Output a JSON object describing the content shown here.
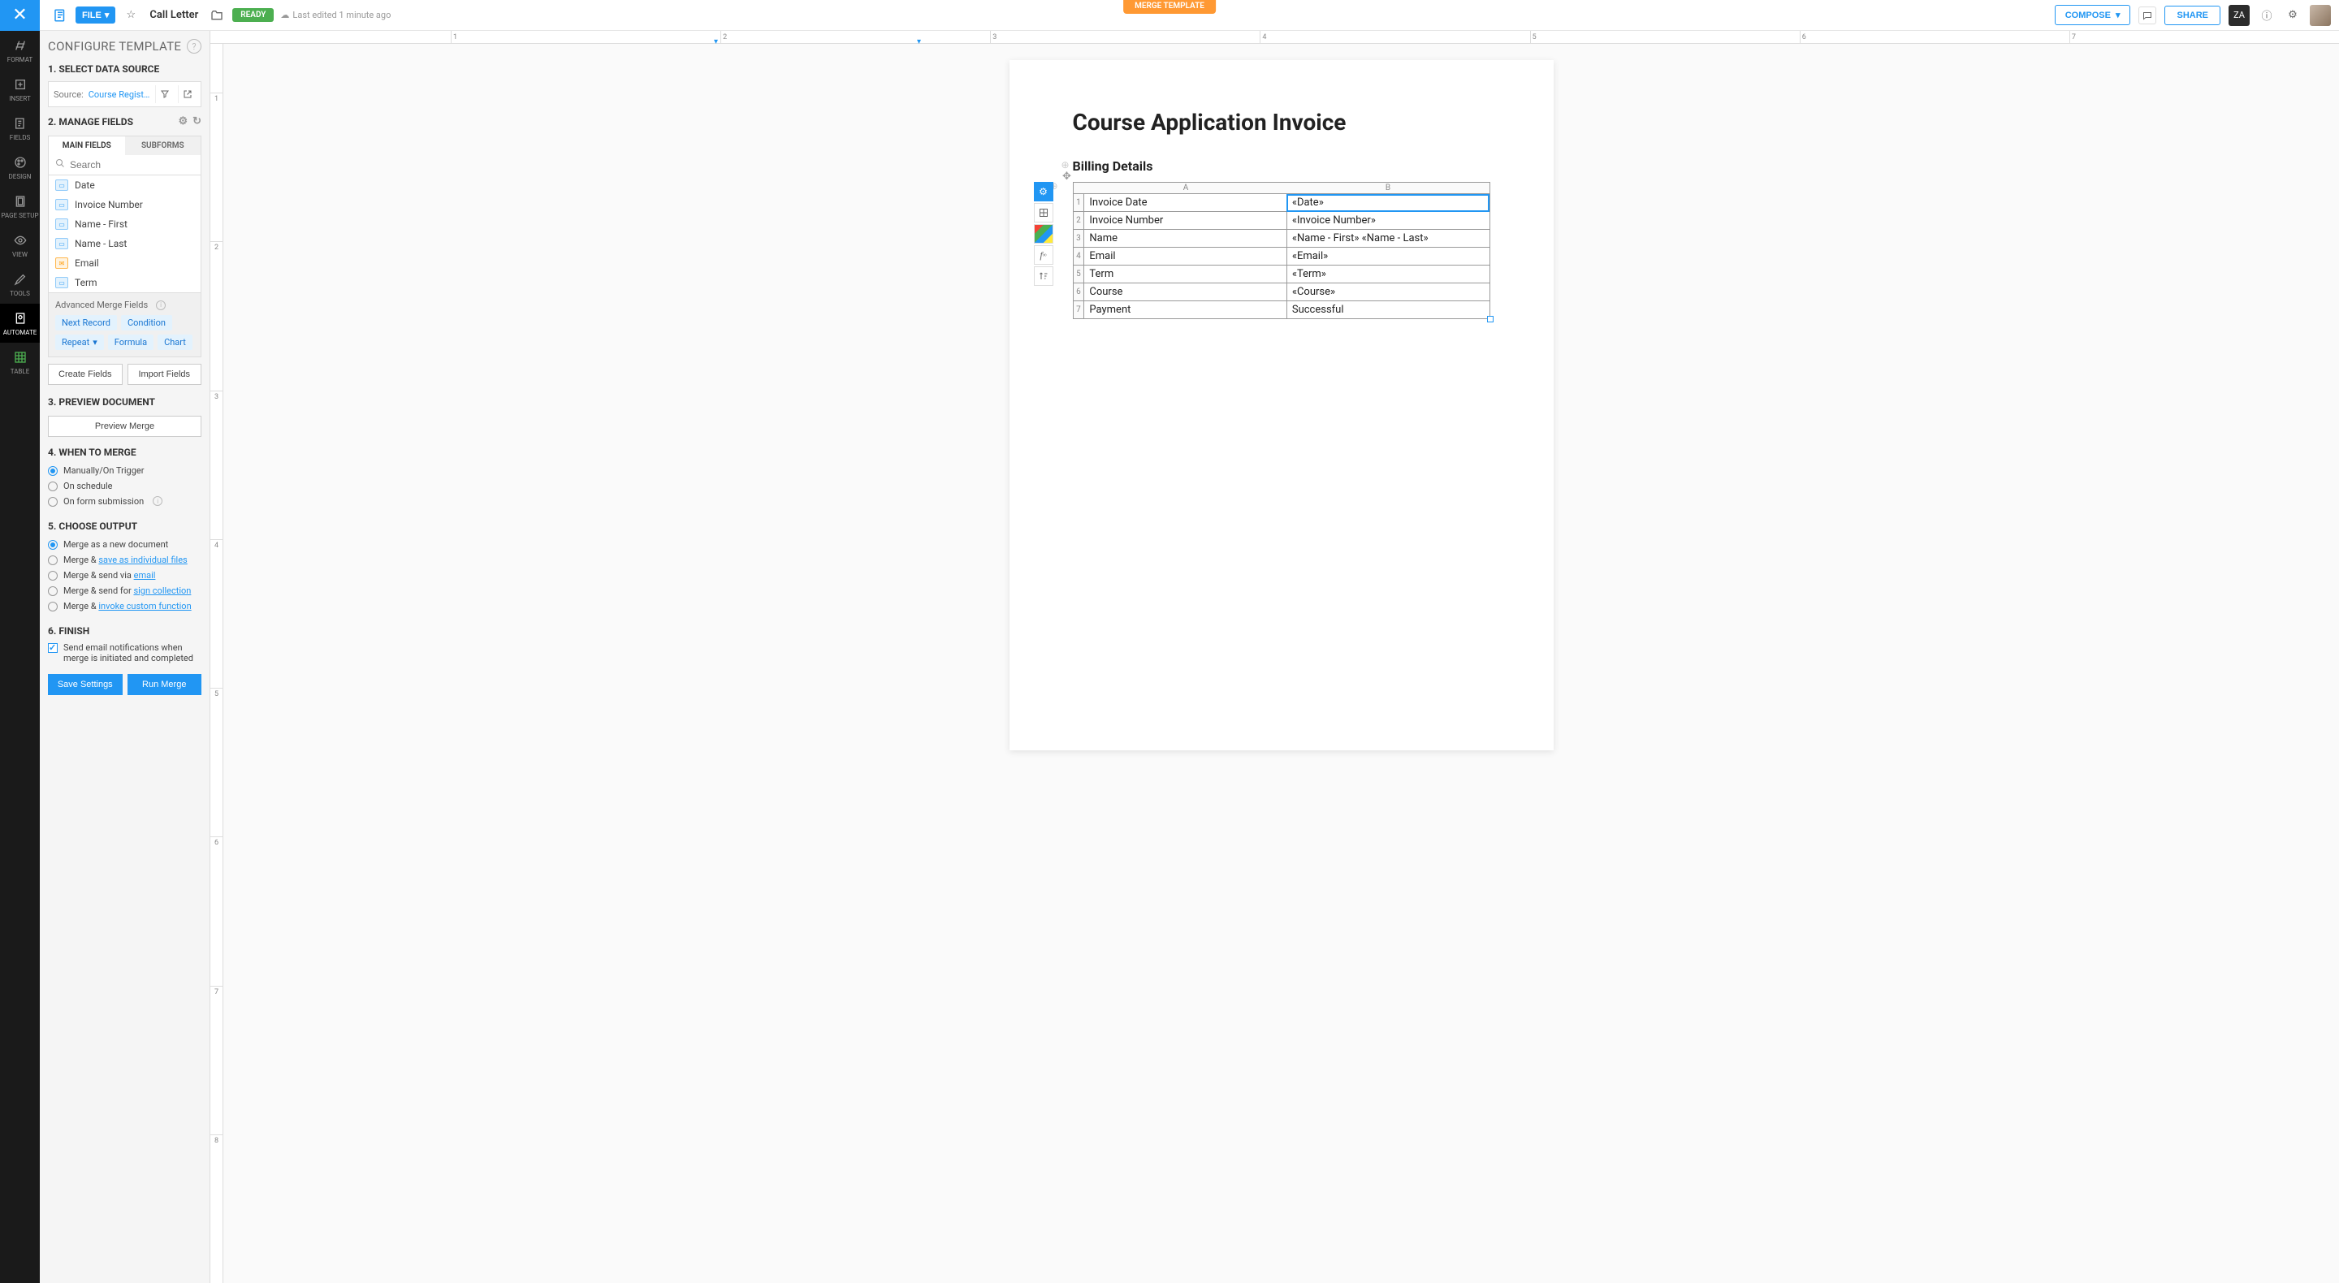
{
  "banner": "MERGE TEMPLATE",
  "toolbar": {
    "file_btn": "FILE",
    "doc_title": "Call Letter",
    "ready": "READY",
    "last_edited": "Last edited 1 minute ago",
    "compose": "COMPOSE",
    "share": "SHARE",
    "user_initials": "ZA"
  },
  "vnav": [
    {
      "label": "FORMAT"
    },
    {
      "label": "INSERT"
    },
    {
      "label": "FIELDS"
    },
    {
      "label": "DESIGN"
    },
    {
      "label": "PAGE SETUP"
    },
    {
      "label": "VIEW"
    },
    {
      "label": "TOOLS"
    },
    {
      "label": "AUTOMATE"
    },
    {
      "label": "TABLE"
    }
  ],
  "panel": {
    "title": "CONFIGURE TEMPLATE",
    "s1": "1. SELECT DATA SOURCE",
    "source_label": "Source:",
    "source_value": "Course Registrati...",
    "s2": "2. MANAGE FIELDS",
    "tab_main": "MAIN FIELDS",
    "tab_sub": "SUBFORMS",
    "search_placeholder": "Search",
    "fields": [
      "Date",
      "Invoice Number",
      "Name - First",
      "Name - Last",
      "Email",
      "Term"
    ],
    "adv_label": "Advanced Merge Fields",
    "chips": [
      "Next Record",
      "Condition",
      "Repeat",
      "Formula",
      "Chart"
    ],
    "create_fields": "Create Fields",
    "import_fields": "Import Fields",
    "s3": "3. PREVIEW DOCUMENT",
    "preview_btn": "Preview Merge",
    "s4": "4. WHEN TO MERGE",
    "when": [
      "Manually/On Trigger",
      "On schedule",
      "On form submission"
    ],
    "s5": "5. CHOOSE OUTPUT",
    "out1": "Merge as a new document",
    "out2_a": "Merge & ",
    "out2_b": "save as individual files",
    "out3_a": "Merge & send via ",
    "out3_b": "email",
    "out4_a": "Merge & send for ",
    "out4_b": "sign collection",
    "out5_a": "Merge & ",
    "out5_b": "invoke custom function",
    "s6": "6. FINISH",
    "finish_check": "Send email notifications when merge is initiated and completed",
    "save_btn": "Save Settings",
    "run_btn": "Run Merge"
  },
  "ruler_h": [
    "1",
    "2",
    "3",
    "4",
    "5",
    "6",
    "7"
  ],
  "ruler_v": [
    "1",
    "2",
    "3",
    "4",
    "5",
    "6",
    "7",
    "8"
  ],
  "doc": {
    "h1": "Course Application Invoice",
    "h2": "Billing Details",
    "col_a": "A",
    "col_b": "B",
    "rows": [
      {
        "n": "1",
        "a": "Invoice Date",
        "b": "«Date»"
      },
      {
        "n": "2",
        "a": "Invoice Number",
        "b": "«Invoice Number»"
      },
      {
        "n": "3",
        "a": "Name",
        "b": "«Name - First» «Name - Last»"
      },
      {
        "n": "4",
        "a": "Email",
        "b": "«Email»"
      },
      {
        "n": "5",
        "a": "Term",
        "b": "«Term»"
      },
      {
        "n": "6",
        "a": "Course",
        "b": "«Course»"
      },
      {
        "n": "7",
        "a": "Payment",
        "b": "Successful"
      }
    ]
  }
}
